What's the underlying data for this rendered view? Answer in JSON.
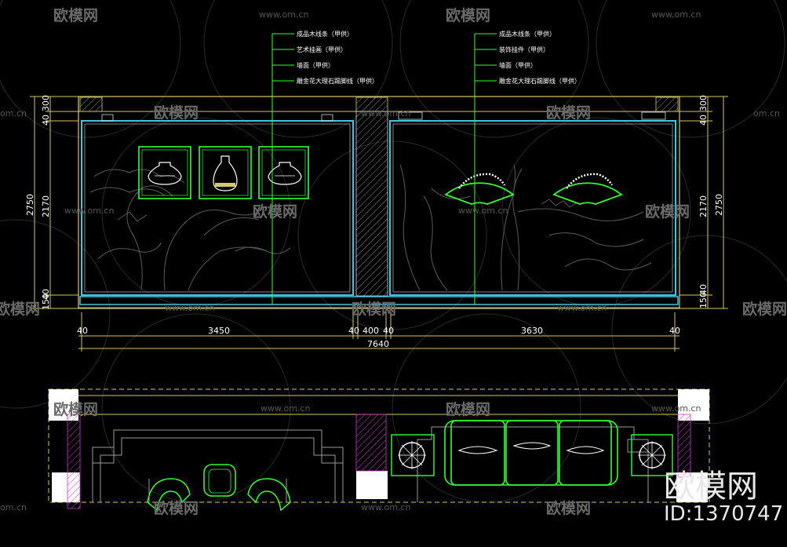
{
  "elevation": {
    "callouts_left": [
      "成品木线条（甲供）",
      "艺术挂画（甲供）",
      "墙面（甲供）",
      "雕金花大理石踢脚线（甲供）"
    ],
    "callouts_right": [
      "成品木线条（甲供）",
      "装饰挂件（甲供）",
      "墙面（甲供）",
      "雕金花大理石踢脚线（甲供）"
    ],
    "dims_bottom": [
      "40",
      "3450",
      "40",
      "400",
      "40",
      "3630",
      "40"
    ],
    "dim_total": "7640",
    "dims_left": [
      "40",
      "300",
      "2170",
      "2750",
      "40",
      "150"
    ],
    "dims_right": [
      "40",
      "300",
      "2170",
      "2750",
      "150",
      "40"
    ]
  },
  "watermark": {
    "logo_text": "欧模网",
    "site_text": "www.om.cn",
    "site_short": "om.cn",
    "id_logo": "欧模网",
    "id_text": "ID:1370747"
  },
  "colors": {
    "frame": "#d4c86a",
    "panel": "#3fc7d8",
    "green": "#33ff33",
    "line": "#d8d8d8",
    "hatch": "#888888",
    "magenta": "#c040c0"
  }
}
